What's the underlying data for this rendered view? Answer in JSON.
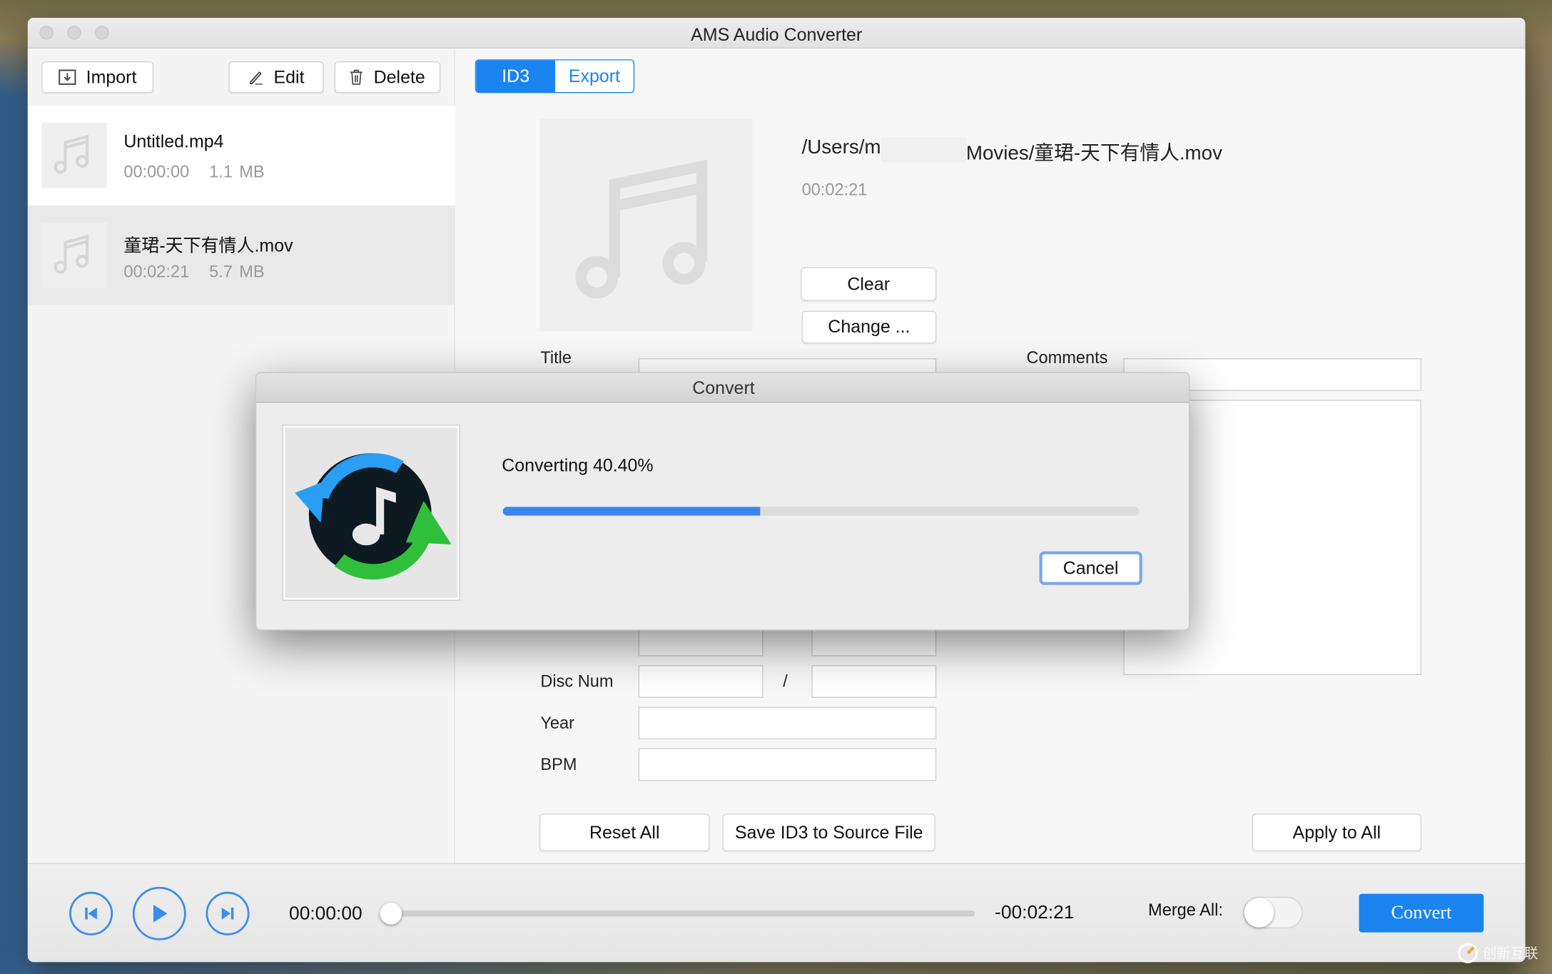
{
  "window": {
    "title": "AMS Audio Converter"
  },
  "toolbar": {
    "import_label": "Import",
    "edit_label": "Edit",
    "delete_label": "Delete"
  },
  "files": [
    {
      "name": "Untitled.mp4",
      "duration": "00:00:00",
      "size": "1.1 MB",
      "selected": false
    },
    {
      "name": "童珺-天下有情人.mov",
      "duration": "00:02:21",
      "size": "5.7 MB",
      "selected": true
    }
  ],
  "tabs": [
    {
      "label": "ID3",
      "active": true
    },
    {
      "label": "Export",
      "active": false
    }
  ],
  "detail": {
    "path_prefix": "/Users/m",
    "path_suffix": "Movies/童珺-天下有情人.mov",
    "duration": "00:02:21",
    "clear_label": "Clear",
    "change_label": "Change ..."
  },
  "form": {
    "title_label": "Title",
    "comments_label": "Comments",
    "disc_num_label": "Disc Num",
    "disc_sep": "/",
    "year_label": "Year",
    "bpm_label": "BPM"
  },
  "actions": {
    "reset_label": "Reset All",
    "save_label": "Save ID3 to Source File",
    "apply_label": "Apply to All"
  },
  "player": {
    "current_time": "00:00:00",
    "remaining_time": "-00:02:21",
    "position_fraction": 0,
    "merge_label": "Merge All:",
    "merge_on": false,
    "convert_label": "Convert"
  },
  "dialog": {
    "title": "Convert",
    "status": "Converting 40.40%",
    "progress_percent": 40.4,
    "cancel_label": "Cancel"
  },
  "watermark": {
    "text": "创新互联"
  },
  "colors": {
    "accent": "#1a84f0",
    "progress": "#3a86f0"
  }
}
